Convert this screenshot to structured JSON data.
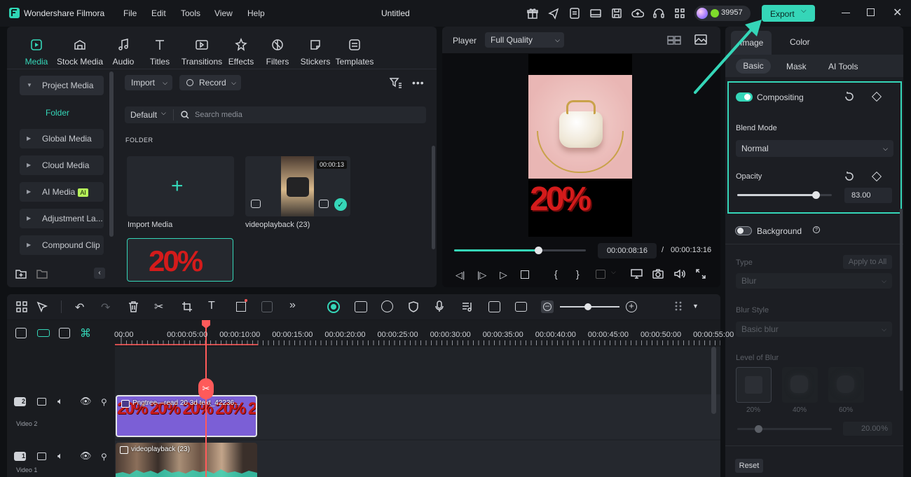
{
  "app": {
    "name": "Wondershare Filmora",
    "doc_title": "Untitled",
    "credits": "39957",
    "export_label": "Export"
  },
  "menu": [
    "File",
    "Edit",
    "Tools",
    "View",
    "Help"
  ],
  "media_tabs": [
    "Media",
    "Stock Media",
    "Audio",
    "Titles",
    "Transitions",
    "Effects",
    "Filters",
    "Stickers",
    "Templates"
  ],
  "sidebar": {
    "project_media": "Project Media",
    "folder": "Folder",
    "items": [
      "Global Media",
      "Cloud Media",
      "AI Media",
      "Adjustment La...",
      "Compound Clip"
    ],
    "ai_badge": "AI"
  },
  "media_toolbar": {
    "import": "Import",
    "record": "Record",
    "sort": "Default",
    "search_placeholder": "Search media",
    "folder_heading": "FOLDER"
  },
  "media_items": [
    {
      "label": "Import Media"
    },
    {
      "label": "videoplayback (23)",
      "duration": "00:00:13"
    }
  ],
  "player": {
    "label": "Player",
    "quality": "Full Quality",
    "current_time": "00:00:08:16",
    "separator": "/",
    "total_time": "00:00:13:16",
    "progress": 0.64,
    "overlay_text": "20%"
  },
  "ruler": [
    "00:00",
    "00:00:05:00",
    "00:00:10:00",
    "00:00:15:00",
    "00:00:20:00",
    "00:00:25:00",
    "00:00:30:00",
    "00:00:35:00",
    "00:00:40:00",
    "00:00:45:00",
    "00:00:50:00",
    "00:00:55:00"
  ],
  "tracks": [
    {
      "number": "2",
      "label": "Video 2",
      "clip": "Pngtree—read 20 3d text_42236...",
      "clip_pattern": "20% 20% 20% 20% 20%"
    },
    {
      "number": "1",
      "label": "Video 1",
      "clip": "videoplayback (23)"
    }
  ],
  "right_panel": {
    "tabs": [
      "Image",
      "Color"
    ],
    "subtabs": [
      "Basic",
      "Mask",
      "AI Tools"
    ],
    "compositing": "Compositing",
    "blend_mode_label": "Blend Mode",
    "blend_mode": "Normal",
    "opacity_label": "Opacity",
    "opacity_value": "83.00",
    "opacity_fraction": 0.83,
    "background": "Background",
    "type_label": "Type",
    "apply_all": "Apply to All",
    "type_value": "Blur",
    "blur_style_label": "Blur Style",
    "blur_style": "Basic blur",
    "level_label": "Level of Blur",
    "levels": [
      "20%",
      "40%",
      "60%"
    ],
    "blur_value": "20.00",
    "blur_unit": "%",
    "reset": "Reset"
  },
  "colors": {
    "accent": "#35d6b8",
    "playhead": "#ff5a5a",
    "clip_purple": "#7b5fd6"
  }
}
